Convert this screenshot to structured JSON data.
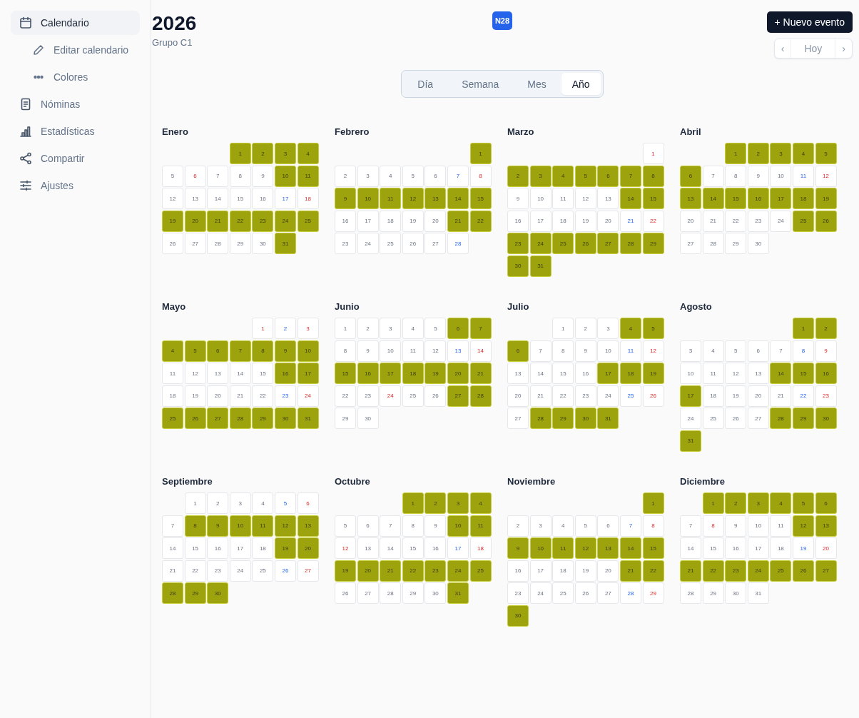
{
  "sidebar": {
    "items": [
      {
        "label": "Calendario",
        "selected": true,
        "children": [
          {
            "label": "Editar calendario",
            "selected": false
          },
          {
            "label": "Colores",
            "selected": false
          }
        ]
      },
      {
        "label": "Nóminas",
        "selected": false
      },
      {
        "label": "Estadísticas",
        "selected": false
      },
      {
        "label": "Compartir",
        "selected": false
      },
      {
        "label": "Ajustes",
        "selected": false
      }
    ]
  },
  "header": {
    "title": "2026",
    "subtitle": "Grupo C1",
    "badge": "N28",
    "new_event_button": "+ Nuevo evento",
    "nav": [
      {
        "label": "‹",
        "disabled": true
      },
      {
        "label": "Hoy",
        "disabled": true
      },
      {
        "label": "›",
        "disabled": true
      }
    ]
  },
  "view_tabs": [
    {
      "label": "Día",
      "selected": false
    },
    {
      "label": "Semana",
      "selected": false
    },
    {
      "label": "Mes",
      "selected": false
    },
    {
      "label": "Año",
      "selected": true
    }
  ],
  "months": [
    {
      "name": "Enero",
      "days": [
        {
          "kind": "blank"
        },
        {
          "kind": "blank"
        },
        {
          "kind": "blank"
        },
        {
          "kind": "day",
          "day": "1",
          "shift": true
        },
        {
          "kind": "day",
          "day": "2",
          "shift": true
        },
        {
          "kind": "day",
          "day": "3",
          "shift": true
        },
        {
          "kind": "day",
          "day": "4",
          "shift": true
        },
        {
          "kind": "day",
          "day": "5",
          "shift": false
        },
        {
          "kind": "holiday",
          "day": "6",
          "shift": false
        },
        {
          "kind": "day",
          "day": "7",
          "shift": false
        },
        {
          "kind": "day",
          "day": "8",
          "shift": false
        },
        {
          "kind": "day",
          "day": "9",
          "shift": false
        },
        {
          "kind": "day",
          "day": "10",
          "shift": true
        },
        {
          "kind": "day",
          "day": "11",
          "shift": true
        },
        {
          "kind": "day",
          "day": "12",
          "shift": false
        },
        {
          "kind": "day",
          "day": "13",
          "shift": false
        },
        {
          "kind": "day",
          "day": "14",
          "shift": false
        },
        {
          "kind": "day",
          "day": "15",
          "shift": false
        },
        {
          "kind": "day",
          "day": "16",
          "shift": false
        },
        {
          "kind": "saturday",
          "day": "17",
          "shift": false
        },
        {
          "kind": "sunday",
          "day": "18",
          "shift": false
        },
        {
          "kind": "day",
          "day": "19",
          "shift": true
        },
        {
          "kind": "day",
          "day": "20",
          "shift": true
        },
        {
          "kind": "day",
          "day": "21",
          "shift": true
        },
        {
          "kind": "day",
          "day": "22",
          "shift": true
        },
        {
          "kind": "day",
          "day": "23",
          "shift": true
        },
        {
          "kind": "day",
          "day": "24",
          "shift": true
        },
        {
          "kind": "day",
          "day": "25",
          "shift": true
        },
        {
          "kind": "day",
          "day": "26",
          "shift": false
        },
        {
          "kind": "day",
          "day": "27",
          "shift": false
        },
        {
          "kind": "day",
          "day": "28",
          "shift": false
        },
        {
          "kind": "day",
          "day": "29",
          "shift": false
        },
        {
          "kind": "day",
          "day": "30",
          "shift": false
        },
        {
          "kind": "day",
          "day": "31",
          "shift": true
        }
      ]
    },
    {
      "name": "Febrero",
      "days": [
        {
          "kind": "blank"
        },
        {
          "kind": "blank"
        },
        {
          "kind": "blank"
        },
        {
          "kind": "blank"
        },
        {
          "kind": "blank"
        },
        {
          "kind": "blank"
        },
        {
          "kind": "day",
          "day": "1",
          "shift": true
        },
        {
          "kind": "day",
          "day": "2",
          "shift": false
        },
        {
          "kind": "day",
          "day": "3",
          "shift": false
        },
        {
          "kind": "day",
          "day": "4",
          "shift": false
        },
        {
          "kind": "day",
          "day": "5",
          "shift": false
        },
        {
          "kind": "day",
          "day": "6",
          "shift": false
        },
        {
          "kind": "saturday",
          "day": "7",
          "shift": false
        },
        {
          "kind": "sunday",
          "day": "8",
          "shift": false
        },
        {
          "kind": "day",
          "day": "9",
          "shift": true
        },
        {
          "kind": "day",
          "day": "10",
          "shift": true
        },
        {
          "kind": "day",
          "day": "11",
          "shift": true
        },
        {
          "kind": "day",
          "day": "12",
          "shift": true
        },
        {
          "kind": "day",
          "day": "13",
          "shift": true
        },
        {
          "kind": "day",
          "day": "14",
          "shift": true
        },
        {
          "kind": "day",
          "day": "15",
          "shift": true
        },
        {
          "kind": "day",
          "day": "16",
          "shift": false
        },
        {
          "kind": "day",
          "day": "17",
          "shift": false
        },
        {
          "kind": "day",
          "day": "18",
          "shift": false
        },
        {
          "kind": "day",
          "day": "19",
          "shift": false
        },
        {
          "kind": "day",
          "day": "20",
          "shift": false
        },
        {
          "kind": "day",
          "day": "21",
          "shift": true
        },
        {
          "kind": "day",
          "day": "22",
          "shift": true
        },
        {
          "kind": "day",
          "day": "23",
          "shift": false
        },
        {
          "kind": "day",
          "day": "24",
          "shift": false
        },
        {
          "kind": "day",
          "day": "25",
          "shift": false
        },
        {
          "kind": "day",
          "day": "26",
          "shift": false
        },
        {
          "kind": "day",
          "day": "27",
          "shift": false
        },
        {
          "kind": "saturday",
          "day": "28",
          "shift": false
        }
      ]
    },
    {
      "name": "Marzo",
      "days": [
        {
          "kind": "blank"
        },
        {
          "kind": "blank"
        },
        {
          "kind": "blank"
        },
        {
          "kind": "blank"
        },
        {
          "kind": "blank"
        },
        {
          "kind": "blank"
        },
        {
          "kind": "sunday",
          "day": "1",
          "shift": false
        },
        {
          "kind": "day",
          "day": "2",
          "shift": true
        },
        {
          "kind": "day",
          "day": "3",
          "shift": true
        },
        {
          "kind": "day",
          "day": "4",
          "shift": true
        },
        {
          "kind": "day",
          "day": "5",
          "shift": true
        },
        {
          "kind": "day",
          "day": "6",
          "shift": true
        },
        {
          "kind": "day",
          "day": "7",
          "shift": true
        },
        {
          "kind": "day",
          "day": "8",
          "shift": true
        },
        {
          "kind": "day",
          "day": "9",
          "shift": false
        },
        {
          "kind": "day",
          "day": "10",
          "shift": false
        },
        {
          "kind": "day",
          "day": "11",
          "shift": false
        },
        {
          "kind": "day",
          "day": "12",
          "shift": false
        },
        {
          "kind": "day",
          "day": "13",
          "shift": false
        },
        {
          "kind": "day",
          "day": "14",
          "shift": true
        },
        {
          "kind": "day",
          "day": "15",
          "shift": true
        },
        {
          "kind": "day",
          "day": "16",
          "shift": false
        },
        {
          "kind": "day",
          "day": "17",
          "shift": false
        },
        {
          "kind": "day",
          "day": "18",
          "shift": false
        },
        {
          "kind": "day",
          "day": "19",
          "shift": false
        },
        {
          "kind": "day",
          "day": "20",
          "shift": false
        },
        {
          "kind": "saturday",
          "day": "21",
          "shift": false
        },
        {
          "kind": "sunday",
          "day": "22",
          "shift": false
        },
        {
          "kind": "day",
          "day": "23",
          "shift": true
        },
        {
          "kind": "day",
          "day": "24",
          "shift": true
        },
        {
          "kind": "day",
          "day": "25",
          "shift": true
        },
        {
          "kind": "day",
          "day": "26",
          "shift": true
        },
        {
          "kind": "day",
          "day": "27",
          "shift": true
        },
        {
          "kind": "day",
          "day": "28",
          "shift": true
        },
        {
          "kind": "day",
          "day": "29",
          "shift": true
        },
        {
          "kind": "day",
          "day": "30",
          "shift": true
        },
        {
          "kind": "day",
          "day": "31",
          "shift": true
        }
      ]
    },
    {
      "name": "Abril",
      "days": [
        {
          "kind": "blank"
        },
        {
          "kind": "blank"
        },
        {
          "kind": "day",
          "day": "1",
          "shift": true
        },
        {
          "kind": "day",
          "day": "2",
          "shift": true
        },
        {
          "kind": "day",
          "day": "3",
          "shift": true
        },
        {
          "kind": "day",
          "day": "4",
          "shift": true
        },
        {
          "kind": "day",
          "day": "5",
          "shift": true
        },
        {
          "kind": "day",
          "day": "6",
          "shift": true
        },
        {
          "kind": "day",
          "day": "7",
          "shift": false
        },
        {
          "kind": "day",
          "day": "8",
          "shift": false
        },
        {
          "kind": "day",
          "day": "9",
          "shift": false
        },
        {
          "kind": "day",
          "day": "10",
          "shift": false
        },
        {
          "kind": "saturday",
          "day": "11",
          "shift": false
        },
        {
          "kind": "sunday",
          "day": "12",
          "shift": false
        },
        {
          "kind": "day",
          "day": "13",
          "shift": true
        },
        {
          "kind": "day",
          "day": "14",
          "shift": true
        },
        {
          "kind": "day",
          "day": "15",
          "shift": true
        },
        {
          "kind": "day",
          "day": "16",
          "shift": true
        },
        {
          "kind": "day",
          "day": "17",
          "shift": true
        },
        {
          "kind": "day",
          "day": "18",
          "shift": true
        },
        {
          "kind": "day",
          "day": "19",
          "shift": true
        },
        {
          "kind": "day",
          "day": "20",
          "shift": false
        },
        {
          "kind": "day",
          "day": "21",
          "shift": false
        },
        {
          "kind": "day",
          "day": "22",
          "shift": false
        },
        {
          "kind": "day",
          "day": "23",
          "shift": false
        },
        {
          "kind": "day",
          "day": "24",
          "shift": false
        },
        {
          "kind": "day",
          "day": "25",
          "shift": true
        },
        {
          "kind": "day",
          "day": "26",
          "shift": true
        },
        {
          "kind": "day",
          "day": "27",
          "shift": false
        },
        {
          "kind": "day",
          "day": "28",
          "shift": false
        },
        {
          "kind": "day",
          "day": "29",
          "shift": false
        },
        {
          "kind": "day",
          "day": "30",
          "shift": false
        }
      ]
    },
    {
      "name": "Mayo",
      "days": [
        {
          "kind": "blank"
        },
        {
          "kind": "blank"
        },
        {
          "kind": "blank"
        },
        {
          "kind": "blank"
        },
        {
          "kind": "holiday",
          "day": "1",
          "shift": false
        },
        {
          "kind": "saturday",
          "day": "2",
          "shift": false
        },
        {
          "kind": "sunday",
          "day": "3",
          "shift": false
        },
        {
          "kind": "day",
          "day": "4",
          "shift": true
        },
        {
          "kind": "day",
          "day": "5",
          "shift": true
        },
        {
          "kind": "day",
          "day": "6",
          "shift": true
        },
        {
          "kind": "day",
          "day": "7",
          "shift": true
        },
        {
          "kind": "day",
          "day": "8",
          "shift": true
        },
        {
          "kind": "day",
          "day": "9",
          "shift": true
        },
        {
          "kind": "day",
          "day": "10",
          "shift": true
        },
        {
          "kind": "day",
          "day": "11",
          "shift": false
        },
        {
          "kind": "day",
          "day": "12",
          "shift": false
        },
        {
          "kind": "day",
          "day": "13",
          "shift": false
        },
        {
          "kind": "day",
          "day": "14",
          "shift": false
        },
        {
          "kind": "day",
          "day": "15",
          "shift": false
        },
        {
          "kind": "day",
          "day": "16",
          "shift": true
        },
        {
          "kind": "day",
          "day": "17",
          "shift": true
        },
        {
          "kind": "day",
          "day": "18",
          "shift": false
        },
        {
          "kind": "day",
          "day": "19",
          "shift": false
        },
        {
          "kind": "day",
          "day": "20",
          "shift": false
        },
        {
          "kind": "day",
          "day": "21",
          "shift": false
        },
        {
          "kind": "day",
          "day": "22",
          "shift": false
        },
        {
          "kind": "saturday",
          "day": "23",
          "shift": false
        },
        {
          "kind": "sunday",
          "day": "24",
          "shift": false
        },
        {
          "kind": "day",
          "day": "25",
          "shift": true
        },
        {
          "kind": "day",
          "day": "26",
          "shift": true
        },
        {
          "kind": "day",
          "day": "27",
          "shift": true
        },
        {
          "kind": "day",
          "day": "28",
          "shift": true
        },
        {
          "kind": "day",
          "day": "29",
          "shift": true
        },
        {
          "kind": "day",
          "day": "30",
          "shift": true
        },
        {
          "kind": "day",
          "day": "31",
          "shift": true
        }
      ]
    },
    {
      "name": "Junio",
      "days": [
        {
          "kind": "day",
          "day": "1",
          "shift": false
        },
        {
          "kind": "day",
          "day": "2",
          "shift": false
        },
        {
          "kind": "day",
          "day": "3",
          "shift": false
        },
        {
          "kind": "day",
          "day": "4",
          "shift": false
        },
        {
          "kind": "day",
          "day": "5",
          "shift": false
        },
        {
          "kind": "day",
          "day": "6",
          "shift": true
        },
        {
          "kind": "day",
          "day": "7",
          "shift": true
        },
        {
          "kind": "day",
          "day": "8",
          "shift": false
        },
        {
          "kind": "day",
          "day": "9",
          "shift": false
        },
        {
          "kind": "day",
          "day": "10",
          "shift": false
        },
        {
          "kind": "day",
          "day": "11",
          "shift": false
        },
        {
          "kind": "day",
          "day": "12",
          "shift": false
        },
        {
          "kind": "saturday",
          "day": "13",
          "shift": false
        },
        {
          "kind": "sunday",
          "day": "14",
          "shift": false
        },
        {
          "kind": "day",
          "day": "15",
          "shift": true
        },
        {
          "kind": "day",
          "day": "16",
          "shift": true
        },
        {
          "kind": "day",
          "day": "17",
          "shift": true
        },
        {
          "kind": "day",
          "day": "18",
          "shift": true
        },
        {
          "kind": "day",
          "day": "19",
          "shift": true
        },
        {
          "kind": "day",
          "day": "20",
          "shift": true
        },
        {
          "kind": "day",
          "day": "21",
          "shift": true
        },
        {
          "kind": "day",
          "day": "22",
          "shift": false
        },
        {
          "kind": "day",
          "day": "23",
          "shift": false
        },
        {
          "kind": "holiday",
          "day": "24",
          "shift": false
        },
        {
          "kind": "day",
          "day": "25",
          "shift": false
        },
        {
          "kind": "day",
          "day": "26",
          "shift": false
        },
        {
          "kind": "day",
          "day": "27",
          "shift": true
        },
        {
          "kind": "day",
          "day": "28",
          "shift": true
        },
        {
          "kind": "day",
          "day": "29",
          "shift": false
        },
        {
          "kind": "day",
          "day": "30",
          "shift": false
        }
      ]
    },
    {
      "name": "Julio",
      "days": [
        {
          "kind": "blank"
        },
        {
          "kind": "blank"
        },
        {
          "kind": "day",
          "day": "1",
          "shift": false
        },
        {
          "kind": "day",
          "day": "2",
          "shift": false
        },
        {
          "kind": "day",
          "day": "3",
          "shift": false
        },
        {
          "kind": "day",
          "day": "4",
          "shift": true
        },
        {
          "kind": "day",
          "day": "5",
          "shift": true
        },
        {
          "kind": "day",
          "day": "6",
          "shift": true
        },
        {
          "kind": "day",
          "day": "7",
          "shift": false
        },
        {
          "kind": "day",
          "day": "8",
          "shift": false
        },
        {
          "kind": "day",
          "day": "9",
          "shift": false
        },
        {
          "kind": "day",
          "day": "10",
          "shift": false
        },
        {
          "kind": "saturday",
          "day": "11",
          "shift": false
        },
        {
          "kind": "sunday",
          "day": "12",
          "shift": false
        },
        {
          "kind": "day",
          "day": "13",
          "shift": false
        },
        {
          "kind": "day",
          "day": "14",
          "shift": false
        },
        {
          "kind": "day",
          "day": "15",
          "shift": false
        },
        {
          "kind": "day",
          "day": "16",
          "shift": false
        },
        {
          "kind": "day",
          "day": "17",
          "shift": true
        },
        {
          "kind": "day",
          "day": "18",
          "shift": true
        },
        {
          "kind": "day",
          "day": "19",
          "shift": true
        },
        {
          "kind": "day",
          "day": "20",
          "shift": false
        },
        {
          "kind": "day",
          "day": "21",
          "shift": false
        },
        {
          "kind": "day",
          "day": "22",
          "shift": false
        },
        {
          "kind": "day",
          "day": "23",
          "shift": false
        },
        {
          "kind": "day",
          "day": "24",
          "shift": false
        },
        {
          "kind": "saturday",
          "day": "25",
          "shift": false
        },
        {
          "kind": "sunday",
          "day": "26",
          "shift": false
        },
        {
          "kind": "day",
          "day": "27",
          "shift": false
        },
        {
          "kind": "day",
          "day": "28",
          "shift": true
        },
        {
          "kind": "day",
          "day": "29",
          "shift": true
        },
        {
          "kind": "day",
          "day": "30",
          "shift": true
        },
        {
          "kind": "day",
          "day": "31",
          "shift": true
        }
      ]
    },
    {
      "name": "Agosto",
      "days": [
        {
          "kind": "blank"
        },
        {
          "kind": "blank"
        },
        {
          "kind": "blank"
        },
        {
          "kind": "blank"
        },
        {
          "kind": "blank"
        },
        {
          "kind": "day",
          "day": "1",
          "shift": true
        },
        {
          "kind": "day",
          "day": "2",
          "shift": true
        },
        {
          "kind": "day",
          "day": "3",
          "shift": false
        },
        {
          "kind": "day",
          "day": "4",
          "shift": false
        },
        {
          "kind": "day",
          "day": "5",
          "shift": false
        },
        {
          "kind": "day",
          "day": "6",
          "shift": false
        },
        {
          "kind": "day",
          "day": "7",
          "shift": false
        },
        {
          "kind": "saturday",
          "day": "8",
          "shift": false
        },
        {
          "kind": "sunday",
          "day": "9",
          "shift": false
        },
        {
          "kind": "day",
          "day": "10",
          "shift": false
        },
        {
          "kind": "day",
          "day": "11",
          "shift": false
        },
        {
          "kind": "day",
          "day": "12",
          "shift": false
        },
        {
          "kind": "day",
          "day": "13",
          "shift": false
        },
        {
          "kind": "day",
          "day": "14",
          "shift": true
        },
        {
          "kind": "day",
          "day": "15",
          "shift": true
        },
        {
          "kind": "day",
          "day": "16",
          "shift": true
        },
        {
          "kind": "day",
          "day": "17",
          "shift": true
        },
        {
          "kind": "day",
          "day": "18",
          "shift": false
        },
        {
          "kind": "day",
          "day": "19",
          "shift": false
        },
        {
          "kind": "day",
          "day": "20",
          "shift": false
        },
        {
          "kind": "day",
          "day": "21",
          "shift": false
        },
        {
          "kind": "saturday",
          "day": "22",
          "shift": false
        },
        {
          "kind": "sunday",
          "day": "23",
          "shift": false
        },
        {
          "kind": "day",
          "day": "24",
          "shift": false
        },
        {
          "kind": "day",
          "day": "25",
          "shift": false
        },
        {
          "kind": "day",
          "day": "26",
          "shift": false
        },
        {
          "kind": "day",
          "day": "27",
          "shift": false
        },
        {
          "kind": "day",
          "day": "28",
          "shift": true
        },
        {
          "kind": "day",
          "day": "29",
          "shift": true
        },
        {
          "kind": "day",
          "day": "30",
          "shift": true
        },
        {
          "kind": "day",
          "day": "31",
          "shift": true
        }
      ]
    },
    {
      "name": "Septiembre",
      "days": [
        {
          "kind": "blank"
        },
        {
          "kind": "day",
          "day": "1",
          "shift": false
        },
        {
          "kind": "day",
          "day": "2",
          "shift": false
        },
        {
          "kind": "day",
          "day": "3",
          "shift": false
        },
        {
          "kind": "day",
          "day": "4",
          "shift": false
        },
        {
          "kind": "saturday",
          "day": "5",
          "shift": false
        },
        {
          "kind": "sunday",
          "day": "6",
          "shift": false
        },
        {
          "kind": "day",
          "day": "7",
          "shift": false
        },
        {
          "kind": "day",
          "day": "8",
          "shift": true
        },
        {
          "kind": "day",
          "day": "9",
          "shift": true
        },
        {
          "kind": "day",
          "day": "10",
          "shift": true
        },
        {
          "kind": "day",
          "day": "11",
          "shift": true
        },
        {
          "kind": "day",
          "day": "12",
          "shift": true
        },
        {
          "kind": "day",
          "day": "13",
          "shift": true
        },
        {
          "kind": "day",
          "day": "14",
          "shift": false
        },
        {
          "kind": "day",
          "day": "15",
          "shift": false
        },
        {
          "kind": "day",
          "day": "16",
          "shift": false
        },
        {
          "kind": "day",
          "day": "17",
          "shift": false
        },
        {
          "kind": "day",
          "day": "18",
          "shift": false
        },
        {
          "kind": "day",
          "day": "19",
          "shift": true
        },
        {
          "kind": "day",
          "day": "20",
          "shift": true
        },
        {
          "kind": "day",
          "day": "21",
          "shift": false
        },
        {
          "kind": "day",
          "day": "22",
          "shift": false
        },
        {
          "kind": "day",
          "day": "23",
          "shift": false
        },
        {
          "kind": "day",
          "day": "24",
          "shift": false
        },
        {
          "kind": "day",
          "day": "25",
          "shift": false
        },
        {
          "kind": "saturday",
          "day": "26",
          "shift": false
        },
        {
          "kind": "sunday",
          "day": "27",
          "shift": false
        },
        {
          "kind": "day",
          "day": "28",
          "shift": true
        },
        {
          "kind": "day",
          "day": "29",
          "shift": true
        },
        {
          "kind": "day",
          "day": "30",
          "shift": true
        }
      ]
    },
    {
      "name": "Octubre",
      "days": [
        {
          "kind": "blank"
        },
        {
          "kind": "blank"
        },
        {
          "kind": "blank"
        },
        {
          "kind": "day",
          "day": "1",
          "shift": true
        },
        {
          "kind": "day",
          "day": "2",
          "shift": true
        },
        {
          "kind": "day",
          "day": "3",
          "shift": true
        },
        {
          "kind": "day",
          "day": "4",
          "shift": true
        },
        {
          "kind": "day",
          "day": "5",
          "shift": false
        },
        {
          "kind": "day",
          "day": "6",
          "shift": false
        },
        {
          "kind": "day",
          "day": "7",
          "shift": false
        },
        {
          "kind": "day",
          "day": "8",
          "shift": false
        },
        {
          "kind": "day",
          "day": "9",
          "shift": false
        },
        {
          "kind": "day",
          "day": "10",
          "shift": true
        },
        {
          "kind": "day",
          "day": "11",
          "shift": true
        },
        {
          "kind": "holiday",
          "day": "12",
          "shift": false
        },
        {
          "kind": "day",
          "day": "13",
          "shift": false
        },
        {
          "kind": "day",
          "day": "14",
          "shift": false
        },
        {
          "kind": "day",
          "day": "15",
          "shift": false
        },
        {
          "kind": "day",
          "day": "16",
          "shift": false
        },
        {
          "kind": "saturday",
          "day": "17",
          "shift": false
        },
        {
          "kind": "sunday",
          "day": "18",
          "shift": false
        },
        {
          "kind": "day",
          "day": "19",
          "shift": true
        },
        {
          "kind": "day",
          "day": "20",
          "shift": true
        },
        {
          "kind": "day",
          "day": "21",
          "shift": true
        },
        {
          "kind": "day",
          "day": "22",
          "shift": true
        },
        {
          "kind": "day",
          "day": "23",
          "shift": true
        },
        {
          "kind": "day",
          "day": "24",
          "shift": true
        },
        {
          "kind": "day",
          "day": "25",
          "shift": true
        },
        {
          "kind": "day",
          "day": "26",
          "shift": false
        },
        {
          "kind": "day",
          "day": "27",
          "shift": false
        },
        {
          "kind": "day",
          "day": "28",
          "shift": false
        },
        {
          "kind": "day",
          "day": "29",
          "shift": false
        },
        {
          "kind": "day",
          "day": "30",
          "shift": false
        },
        {
          "kind": "day",
          "day": "31",
          "shift": true
        }
      ]
    },
    {
      "name": "Noviembre",
      "days": [
        {
          "kind": "blank"
        },
        {
          "kind": "blank"
        },
        {
          "kind": "blank"
        },
        {
          "kind": "blank"
        },
        {
          "kind": "blank"
        },
        {
          "kind": "blank"
        },
        {
          "kind": "day",
          "day": "1",
          "shift": true
        },
        {
          "kind": "day",
          "day": "2",
          "shift": false
        },
        {
          "kind": "day",
          "day": "3",
          "shift": false
        },
        {
          "kind": "day",
          "day": "4",
          "shift": false
        },
        {
          "kind": "day",
          "day": "5",
          "shift": false
        },
        {
          "kind": "day",
          "day": "6",
          "shift": false
        },
        {
          "kind": "saturday",
          "day": "7",
          "shift": false
        },
        {
          "kind": "sunday",
          "day": "8",
          "shift": false
        },
        {
          "kind": "day",
          "day": "9",
          "shift": true
        },
        {
          "kind": "day",
          "day": "10",
          "shift": true
        },
        {
          "kind": "day",
          "day": "11",
          "shift": true
        },
        {
          "kind": "day",
          "day": "12",
          "shift": true
        },
        {
          "kind": "day",
          "day": "13",
          "shift": true
        },
        {
          "kind": "day",
          "day": "14",
          "shift": true
        },
        {
          "kind": "day",
          "day": "15",
          "shift": true
        },
        {
          "kind": "day",
          "day": "16",
          "shift": false
        },
        {
          "kind": "day",
          "day": "17",
          "shift": false
        },
        {
          "kind": "day",
          "day": "18",
          "shift": false
        },
        {
          "kind": "day",
          "day": "19",
          "shift": false
        },
        {
          "kind": "day",
          "day": "20",
          "shift": false
        },
        {
          "kind": "day",
          "day": "21",
          "shift": true
        },
        {
          "kind": "day",
          "day": "22",
          "shift": true
        },
        {
          "kind": "day",
          "day": "23",
          "shift": false
        },
        {
          "kind": "day",
          "day": "24",
          "shift": false
        },
        {
          "kind": "day",
          "day": "25",
          "shift": false
        },
        {
          "kind": "day",
          "day": "26",
          "shift": false
        },
        {
          "kind": "day",
          "day": "27",
          "shift": false
        },
        {
          "kind": "saturday",
          "day": "28",
          "shift": false
        },
        {
          "kind": "sunday",
          "day": "29",
          "shift": false
        },
        {
          "kind": "day",
          "day": "30",
          "shift": true
        }
      ]
    },
    {
      "name": "Diciembre",
      "days": [
        {
          "kind": "blank"
        },
        {
          "kind": "day",
          "day": "1",
          "shift": true
        },
        {
          "kind": "day",
          "day": "2",
          "shift": true
        },
        {
          "kind": "day",
          "day": "3",
          "shift": true
        },
        {
          "kind": "day",
          "day": "4",
          "shift": true
        },
        {
          "kind": "day",
          "day": "5",
          "shift": true
        },
        {
          "kind": "day",
          "day": "6",
          "shift": true
        },
        {
          "kind": "day",
          "day": "7",
          "shift": false
        },
        {
          "kind": "holiday",
          "day": "8",
          "shift": false
        },
        {
          "kind": "day",
          "day": "9",
          "shift": false
        },
        {
          "kind": "day",
          "day": "10",
          "shift": false
        },
        {
          "kind": "day",
          "day": "11",
          "shift": false
        },
        {
          "kind": "day",
          "day": "12",
          "shift": true
        },
        {
          "kind": "day",
          "day": "13",
          "shift": true
        },
        {
          "kind": "day",
          "day": "14",
          "shift": false
        },
        {
          "kind": "day",
          "day": "15",
          "shift": false
        },
        {
          "kind": "day",
          "day": "16",
          "shift": false
        },
        {
          "kind": "day",
          "day": "17",
          "shift": false
        },
        {
          "kind": "day",
          "day": "18",
          "shift": false
        },
        {
          "kind": "saturday",
          "day": "19",
          "shift": false
        },
        {
          "kind": "sunday",
          "day": "20",
          "shift": false
        },
        {
          "kind": "day",
          "day": "21",
          "shift": true
        },
        {
          "kind": "day",
          "day": "22",
          "shift": true
        },
        {
          "kind": "day",
          "day": "23",
          "shift": true
        },
        {
          "kind": "day",
          "day": "24",
          "shift": true
        },
        {
          "kind": "day",
          "day": "25",
          "shift": true
        },
        {
          "kind": "day",
          "day": "26",
          "shift": true
        },
        {
          "kind": "day",
          "day": "27",
          "shift": true
        },
        {
          "kind": "day",
          "day": "28",
          "shift": false
        },
        {
          "kind": "day",
          "day": "29",
          "shift": false
        },
        {
          "kind": "day",
          "day": "30",
          "shift": false
        },
        {
          "kind": "day",
          "day": "31",
          "shift": false
        }
      ]
    }
  ]
}
